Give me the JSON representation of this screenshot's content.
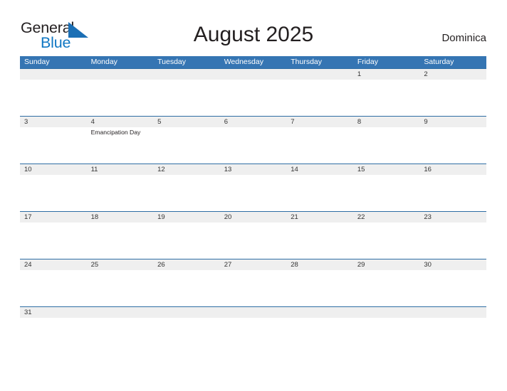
{
  "brand": {
    "word1": "General",
    "word2": "Blue",
    "triangle_icon": "brand-triangle-icon",
    "word1_color": "#231f20",
    "word2_color": "#1077c3",
    "triangle_color": "#1b6fb5"
  },
  "header": {
    "title": "August 2025",
    "region": "Dominica"
  },
  "colors": {
    "header_blue": "#3575b3",
    "row_border_blue": "#2e6da4",
    "date_band_gray": "#efefef",
    "page_background": "#ffffff",
    "text": "#231f20"
  },
  "calendar": {
    "weekdays": [
      "Sunday",
      "Monday",
      "Tuesday",
      "Wednesday",
      "Thursday",
      "Friday",
      "Saturday"
    ],
    "weeks": [
      {
        "height": "tall",
        "days": [
          {
            "date": "",
            "event": ""
          },
          {
            "date": "",
            "event": ""
          },
          {
            "date": "",
            "event": ""
          },
          {
            "date": "",
            "event": ""
          },
          {
            "date": "",
            "event": ""
          },
          {
            "date": "1",
            "event": ""
          },
          {
            "date": "2",
            "event": ""
          }
        ]
      },
      {
        "height": "tall",
        "days": [
          {
            "date": "3",
            "event": ""
          },
          {
            "date": "4",
            "event": "Emancipation Day"
          },
          {
            "date": "5",
            "event": ""
          },
          {
            "date": "6",
            "event": ""
          },
          {
            "date": "7",
            "event": ""
          },
          {
            "date": "8",
            "event": ""
          },
          {
            "date": "9",
            "event": ""
          }
        ]
      },
      {
        "height": "tall",
        "days": [
          {
            "date": "10",
            "event": ""
          },
          {
            "date": "11",
            "event": ""
          },
          {
            "date": "12",
            "event": ""
          },
          {
            "date": "13",
            "event": ""
          },
          {
            "date": "14",
            "event": ""
          },
          {
            "date": "15",
            "event": ""
          },
          {
            "date": "16",
            "event": ""
          }
        ]
      },
      {
        "height": "tall",
        "days": [
          {
            "date": "17",
            "event": ""
          },
          {
            "date": "18",
            "event": ""
          },
          {
            "date": "19",
            "event": ""
          },
          {
            "date": "20",
            "event": ""
          },
          {
            "date": "21",
            "event": ""
          },
          {
            "date": "22",
            "event": ""
          },
          {
            "date": "23",
            "event": ""
          }
        ]
      },
      {
        "height": "tall",
        "days": [
          {
            "date": "24",
            "event": ""
          },
          {
            "date": "25",
            "event": ""
          },
          {
            "date": "26",
            "event": ""
          },
          {
            "date": "27",
            "event": ""
          },
          {
            "date": "28",
            "event": ""
          },
          {
            "date": "29",
            "event": ""
          },
          {
            "date": "30",
            "event": ""
          }
        ]
      },
      {
        "height": "short",
        "days": [
          {
            "date": "31",
            "event": ""
          },
          {
            "date": "",
            "event": ""
          },
          {
            "date": "",
            "event": ""
          },
          {
            "date": "",
            "event": ""
          },
          {
            "date": "",
            "event": ""
          },
          {
            "date": "",
            "event": ""
          },
          {
            "date": "",
            "event": ""
          }
        ]
      }
    ]
  }
}
